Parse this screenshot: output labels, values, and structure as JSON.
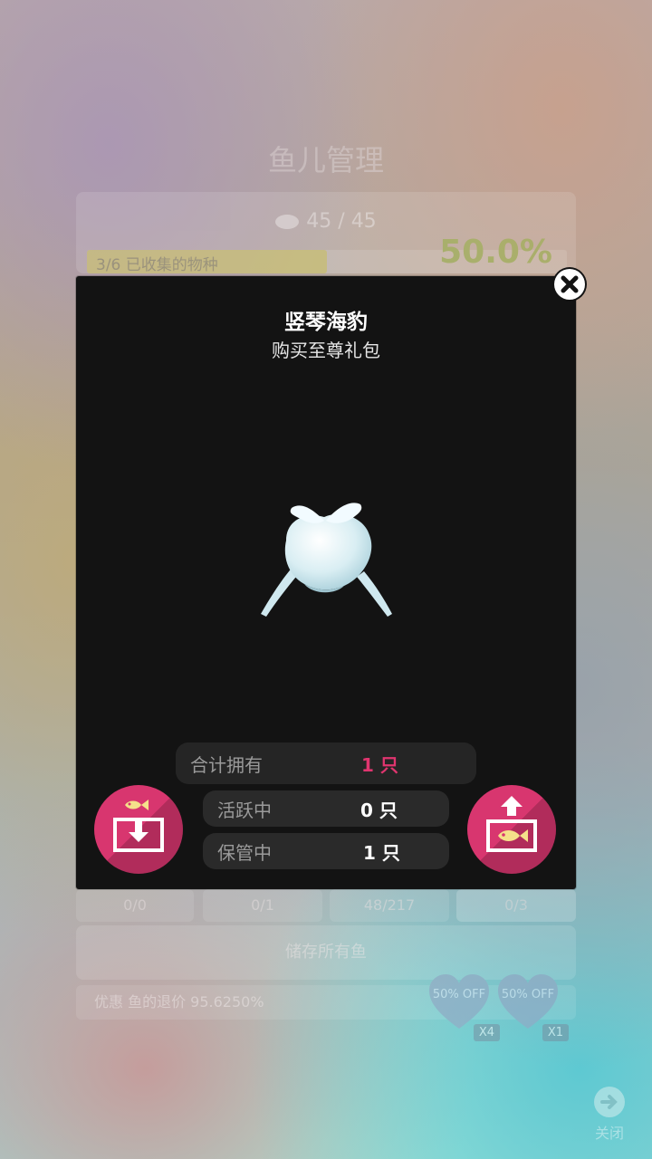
{
  "background": {
    "title": "鱼儿管理",
    "fish_count": "45 / 45",
    "collected_label": "3/6 已收集的物种",
    "collected_fraction": 0.5,
    "percent": "50.0%",
    "stats": [
      "0/0",
      "0/1",
      "48/217",
      "0/3"
    ],
    "store_all": "储存所有鱼",
    "price_label": "优惠 鱼的退价 95.6250%",
    "offers": [
      {
        "text": "50% OFF",
        "badge": "X4"
      },
      {
        "text": "50% OFF",
        "badge": "X1"
      }
    ],
    "close_label": "关闭"
  },
  "modal": {
    "title": "竖琴海豹",
    "subtitle": "购买至尊礼包",
    "total_label": "合计拥有",
    "total_value": "1 只",
    "active_label": "活跃中",
    "active_value": "0 只",
    "stored_label": "保管中",
    "stored_value": "1 只"
  },
  "colors": {
    "accent": "#d8366f",
    "total_value": "#e0356f",
    "modal_bg": "#131313",
    "fish_icon": "#f5e08a"
  },
  "icons": {
    "close": "close-icon",
    "store": "store-fish-icon",
    "release": "release-fish-icon",
    "creature": "harp-seal-image"
  }
}
